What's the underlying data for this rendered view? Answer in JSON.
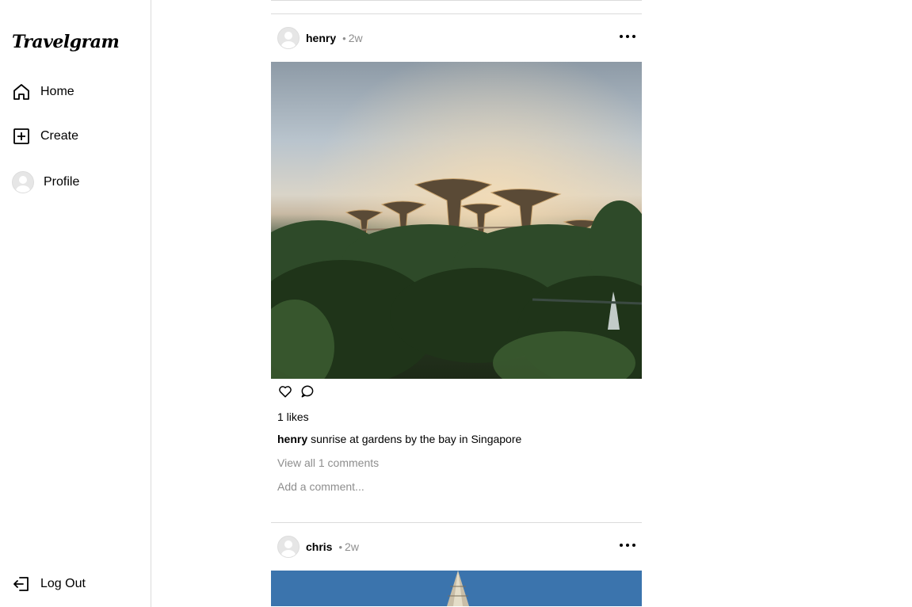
{
  "sidebar": {
    "logo": "Travelgram",
    "items": [
      {
        "label": "Home",
        "icon": "home-icon"
      },
      {
        "label": "Create",
        "icon": "plus-square-icon"
      },
      {
        "label": "Profile",
        "icon": "avatar"
      }
    ],
    "logout": {
      "label": "Log Out",
      "icon": "logout-icon"
    }
  },
  "posts": [
    {
      "username": "henry",
      "time": "2w",
      "likes_text": "1 likes",
      "caption_user": "henry",
      "caption_text": "sunrise at gardens by the bay in Singapore",
      "view_comments": "View all 1 comments",
      "add_comment_placeholder": "Add a comment..."
    },
    {
      "username": "chris",
      "time": "2w"
    }
  ],
  "separator": "•"
}
